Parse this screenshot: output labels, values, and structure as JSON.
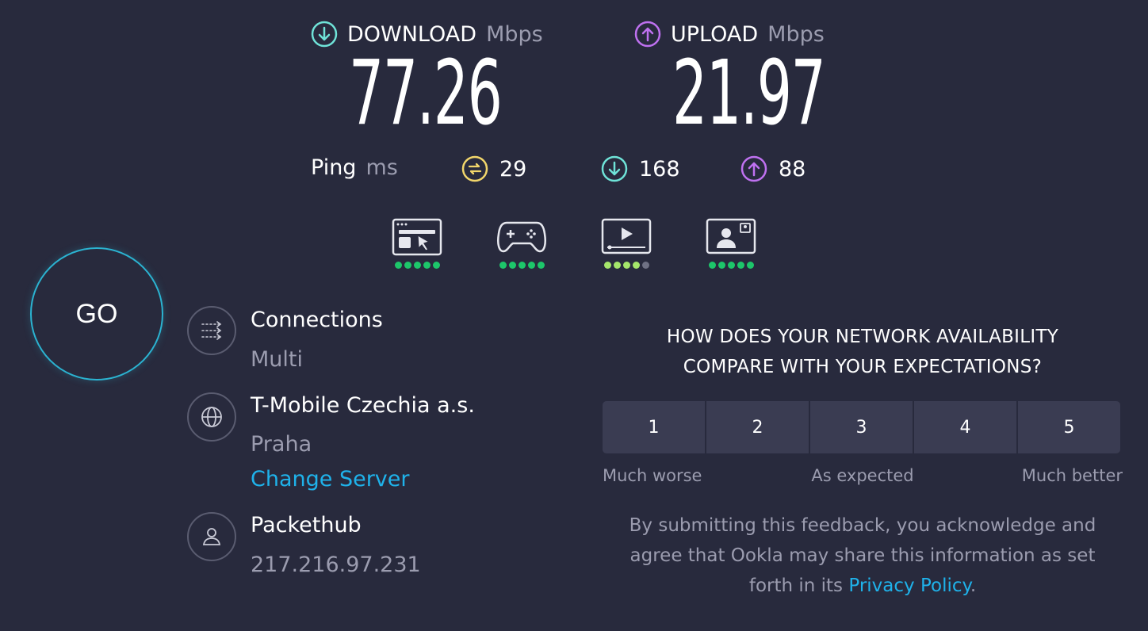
{
  "download": {
    "label": "DOWNLOAD",
    "unit": "Mbps",
    "value": "77.26",
    "icon": "download-arrow-icon"
  },
  "upload": {
    "label": "UPLOAD",
    "unit": "Mbps",
    "value": "21.97",
    "icon": "upload-arrow-icon"
  },
  "ping": {
    "label": "Ping",
    "unit": "ms",
    "idle": "29",
    "download": "168",
    "upload": "88"
  },
  "apps": [
    {
      "name": "web-browsing-icon",
      "rating": 5,
      "dot_color": "#1dc66a"
    },
    {
      "name": "gaming-icon",
      "rating": 5,
      "dot_color": "#1dc66a"
    },
    {
      "name": "video-streaming-icon",
      "rating": 4,
      "dot_color": "#a5e66b"
    },
    {
      "name": "video-call-icon",
      "rating": 5,
      "dot_color": "#1dc66a"
    }
  ],
  "go_label": "GO",
  "connections": {
    "title": "Connections",
    "value": "Multi"
  },
  "server": {
    "title": "T-Mobile Czechia a.s.",
    "location": "Praha",
    "change_label": "Change Server"
  },
  "provider": {
    "title": "Packethub",
    "ip": "217.216.97.231"
  },
  "survey": {
    "question_line1": "HOW DOES YOUR NETWORK AVAILABILITY",
    "question_line2": "COMPARE WITH YOUR EXPECTATIONS?",
    "options": [
      "1",
      "2",
      "3",
      "4",
      "5"
    ],
    "label_low": "Much worse",
    "label_mid": "As expected",
    "label_high": "Much better",
    "disclaimer_line1": "By submitting this feedback, you acknowledge and",
    "disclaimer_line2": "agree that Ookla may share this information as set",
    "disclaimer_prefix": "forth in its ",
    "privacy_link": "Privacy Policy",
    "disclaimer_suffix": "."
  },
  "colors": {
    "background": "#282a3d",
    "download_accent": "#6fe3d8",
    "upload_accent": "#bf71f0",
    "ping_accent": "#f2d66b",
    "link": "#1fb2ea",
    "go_ring": "#2bb3d1"
  }
}
